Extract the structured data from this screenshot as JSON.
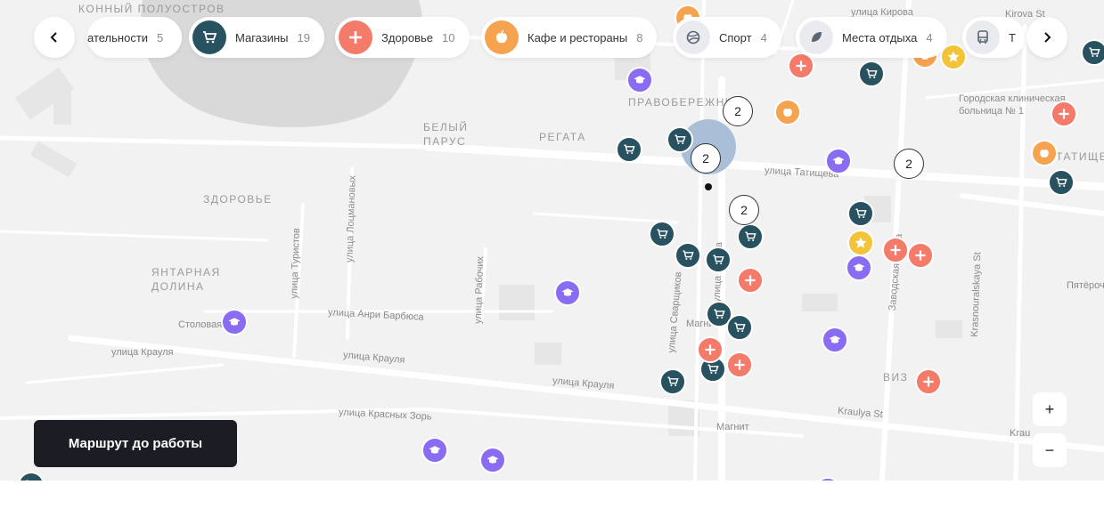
{
  "categories": [
    {
      "key": "edu",
      "label": "Образовательности",
      "display": "ательности",
      "count": "5",
      "color": "#8a6cf2",
      "icon": "graduation-cap-icon"
    },
    {
      "key": "shops",
      "label": "Магазины",
      "count": "19",
      "color": "#285260",
      "icon": "shopping-cart-icon"
    },
    {
      "key": "health",
      "label": "Здоровье",
      "count": "10",
      "color": "#f47a6a",
      "icon": "plus-icon"
    },
    {
      "key": "cafe",
      "label": "Кафе и рестораны",
      "count": "8",
      "color": "#f6a350",
      "icon": "apple-icon"
    },
    {
      "key": "sport",
      "label": "Спорт",
      "count": "4",
      "color": "#e9ebef",
      "icon": "ball-icon"
    },
    {
      "key": "rest",
      "label": "Места отдыха",
      "count": "4",
      "color": "#e9ebef",
      "icon": "leaf-icon"
    },
    {
      "key": "transport",
      "label": "Т",
      "count": "",
      "color": "#e9ebef",
      "icon": "bus-icon"
    }
  ],
  "nav": {
    "prev": "‹",
    "next": "›"
  },
  "zoom": {
    "in": "+",
    "out": "−"
  },
  "route_button": "Маршрут до работы",
  "map_labels": {
    "district_konny": "КОННЫЙ\nПОЛУОСТРОВ",
    "district_pravoberezhny": "ПРАВОБЕРЕЖНЫЙ",
    "district_bely_parus": "БЕЛЫЙ\nПАРУС",
    "district_regata": "РЕГАТА",
    "district_zdorovye": "ЗДОРОВЬЕ",
    "district_yantarnaya": "ЯНТАРНАЯ\nДОЛИНА",
    "district_tatishchevo": "ТАТИЩЕВО",
    "district_viz": "ВИЗ",
    "street_kirova": "улица Кирова",
    "street_kirova_en": "Kirova St",
    "street_tatishcheva": "улица Татищева",
    "street_krauly_1": "улица Крауля",
    "street_krauly_2": "улица Крауля",
    "street_krauly_3": "улица Крауля",
    "street_kraulya_en": "Kraulya St",
    "street_kraulya_en_2": "Krau",
    "street_barbusa": "улица Анри Барбюса",
    "street_krasnykh_zor": "улица Красных Зорь",
    "street_turistov": "улица Туристов",
    "street_lotsmanov": "улица Лоцмановых",
    "street_rabochikh": "улица Рабочих",
    "street_sverdlova": "улица Сварщиков",
    "street_vazh": "улица Гурова",
    "street_zavodskaya": "Заводская улица",
    "street_krasnouralskaya": "Krasnouralskaya St",
    "hospital": "Городская клиническая\nбольница № 1",
    "stolovaya": "Столовая",
    "magnit_1": "Магнит",
    "magnit_2": "Магнит",
    "pyaterochka": "Пятёрочка"
  },
  "clusters": [
    "2",
    "2",
    "2",
    "2"
  ]
}
